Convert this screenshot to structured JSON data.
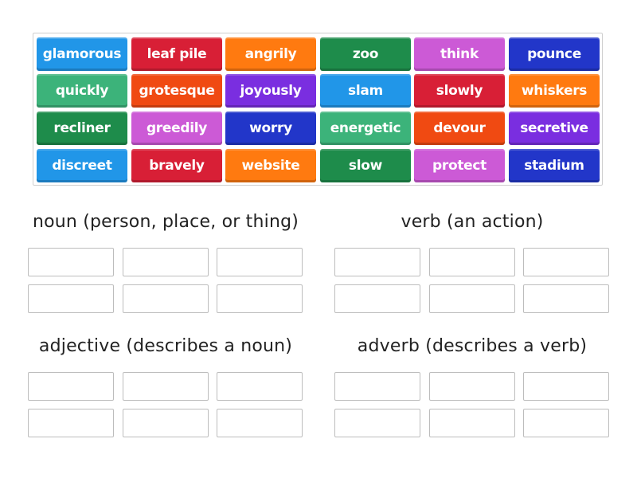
{
  "tiles": [
    {
      "word": "glamorous",
      "color": "#2196e8"
    },
    {
      "word": "leaf pile",
      "color": "#d81f36"
    },
    {
      "word": "angrily",
      "color": "#ff7a10"
    },
    {
      "word": "zoo",
      "color": "#1e8c4b"
    },
    {
      "word": "think",
      "color": "#cc5ad6"
    },
    {
      "word": "pounce",
      "color": "#2236c9"
    },
    {
      "word": "quickly",
      "color": "#3cb37a"
    },
    {
      "word": "grotesque",
      "color": "#f04a12"
    },
    {
      "word": "joyously",
      "color": "#7a2ee0"
    },
    {
      "word": "slam",
      "color": "#2196e8"
    },
    {
      "word": "slowly",
      "color": "#d81f36"
    },
    {
      "word": "whiskers",
      "color": "#ff7a10"
    },
    {
      "word": "recliner",
      "color": "#1e8c4b"
    },
    {
      "word": "greedily",
      "color": "#cc5ad6"
    },
    {
      "word": "worry",
      "color": "#2236c9"
    },
    {
      "word": "energetic",
      "color": "#3cb37a"
    },
    {
      "word": "devour",
      "color": "#f04a12"
    },
    {
      "word": "secretive",
      "color": "#7a2ee0"
    },
    {
      "word": "discreet",
      "color": "#2196e8"
    },
    {
      "word": "bravely",
      "color": "#d81f36"
    },
    {
      "word": "website",
      "color": "#ff7a10"
    },
    {
      "word": "slow",
      "color": "#1e8c4b"
    },
    {
      "word": "protect",
      "color": "#cc5ad6"
    },
    {
      "word": "stadium",
      "color": "#2236c9"
    }
  ],
  "groups": [
    {
      "title": "noun (person, place, or thing)",
      "slots": 6
    },
    {
      "title": "verb (an action)",
      "slots": 6
    },
    {
      "title": "adjective (describes a noun)",
      "slots": 6
    },
    {
      "title": "adverb (describes a verb)",
      "slots": 6
    }
  ]
}
